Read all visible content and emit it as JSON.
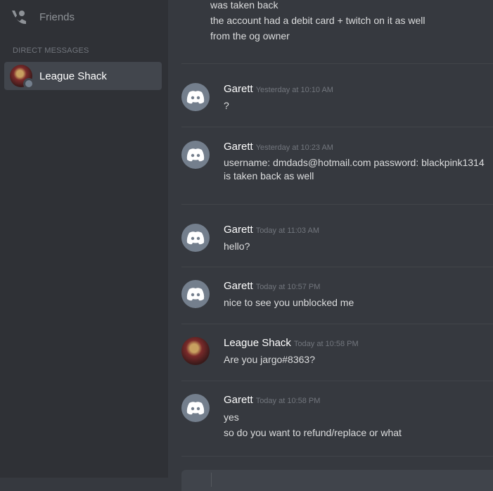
{
  "sidebar": {
    "friends_label": "Friends",
    "dm_header": "DIRECT MESSAGES",
    "dm_items": [
      {
        "name": "League Shack",
        "status": "offline"
      }
    ]
  },
  "chat": {
    "top_lines": [
      "was taken back",
      "the account had a debit card + twitch on it as well",
      "from the og owner"
    ],
    "messages": [
      {
        "author": "Garett",
        "timestamp": "Yesterday at 10:10 AM",
        "lines": [
          "?"
        ],
        "avatar": "discord-logo-icon"
      },
      {
        "author": "Garett",
        "timestamp": "Yesterday at 10:23 AM",
        "lines": [
          "username: dmdads@hotmail.com password: blackpink1314",
          "is taken back as well"
        ],
        "avatar": "discord-logo-icon"
      },
      {
        "author": "Garett",
        "timestamp": "Today at 11:03 AM",
        "lines": [
          "hello?"
        ],
        "avatar": "discord-logo-icon"
      },
      {
        "author": "Garett",
        "timestamp": "Today at 10:57 PM",
        "lines": [
          "nice to see you unblocked me"
        ],
        "avatar": "discord-logo-icon"
      },
      {
        "author": "League Shack",
        "timestamp": "Today at 10:58 PM",
        "lines": [
          "Are you jargo#8363?"
        ],
        "avatar": "league-shack-avatar"
      },
      {
        "author": "Garett",
        "timestamp": "Today at 10:58 PM",
        "lines": [
          "yes",
          "so do you want to refund/replace or what"
        ],
        "avatar": "discord-logo-icon"
      }
    ]
  },
  "colors": {
    "background": "#36393f",
    "sidebar": "#2f3136",
    "selected": "#42464d",
    "text": "#dcddde",
    "muted": "#72767d",
    "default_avatar": "#747f8d"
  }
}
